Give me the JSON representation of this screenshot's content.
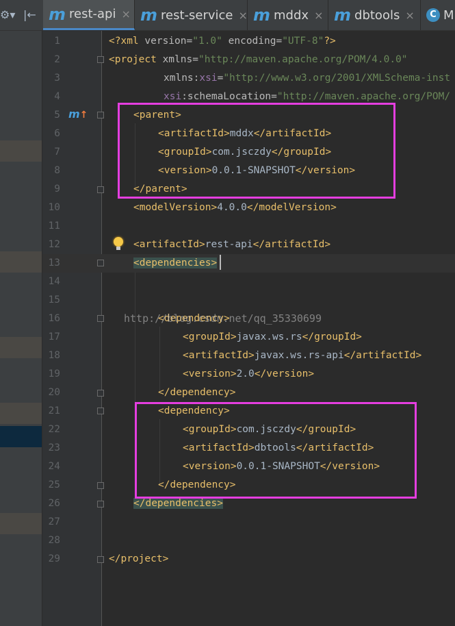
{
  "toolbar": {
    "settings_icon": "⚙▾",
    "collapse_icon": "|←"
  },
  "tabs": [
    {
      "icon": "m",
      "label": "rest-api",
      "close": "×",
      "active": true
    },
    {
      "icon": "m",
      "label": "rest-service",
      "close": "×"
    },
    {
      "icon": "m",
      "label": "mddx",
      "close": "×"
    },
    {
      "icon": "m",
      "label": "dbtools",
      "close": "×"
    },
    {
      "icon": "C",
      "label": "M"
    }
  ],
  "editor": {
    "line_numbers": [
      "1",
      "2",
      "3",
      "4",
      "5",
      "6",
      "7",
      "8",
      "9",
      "10",
      "11",
      "12",
      "13",
      "14",
      "15",
      "16",
      "17",
      "18",
      "19",
      "20",
      "21",
      "22",
      "23",
      "24",
      "25",
      "26",
      "27",
      "28",
      "29"
    ],
    "code": {
      "l1": {
        "a": "<?xml ",
        "b": "version",
        "c": "=",
        "d": "\"1.0\"",
        "e": " ",
        "f": "encoding",
        "g": "=",
        "h": "\"UTF-8\"",
        "i": "?>"
      },
      "l2": {
        "a": "<project ",
        "b": "xmlns",
        "c": "=",
        "d": "\"http://maven.apache.org/POM/4.0.0\""
      },
      "l3": {
        "a": "xmlns",
        "b": ":",
        "c": "xsi",
        "d": "=",
        "e": "\"http://www.w3.org/2001/XMLSchema-inst"
      },
      "l4": {
        "a": "xsi",
        "b": ":schemaLocation",
        "c": "=",
        "d": "\"http://maven.apache.org/POM/"
      },
      "l5": {
        "a": "<parent>"
      },
      "l6": {
        "a": "<artifactId>",
        "b": "mddx",
        "c": "</artifactId>"
      },
      "l7": {
        "a": "<groupId>",
        "b": "com.jsczdy",
        "c": "</groupId>"
      },
      "l8": {
        "a": "<version>",
        "b": "0.0.1-SNAPSHOT",
        "c": "</version>"
      },
      "l9": {
        "a": "</parent>"
      },
      "l10": {
        "a": "<modelVersion>",
        "b": "4.0.0",
        "c": "</modelVersion>"
      },
      "l12": {
        "a": "<artifactId>",
        "b": "rest-api",
        "c": "</artifactId>"
      },
      "l13": {
        "a": "<dependencies>"
      },
      "l16": {
        "a": "<dependency>"
      },
      "l17": {
        "a": "<groupId>",
        "b": "javax.ws.rs",
        "c": "</groupId>"
      },
      "l18": {
        "a": "<artifactId>",
        "b": "javax.ws.rs-api",
        "c": "</artifactId>"
      },
      "l19": {
        "a": "<version>",
        "b": "2.0",
        "c": "</version>"
      },
      "l20": {
        "a": "</dependency>"
      },
      "l21": {
        "a": "<dependency>"
      },
      "l22": {
        "a": "<groupId>",
        "b": "com.jsczdy",
        "c": "</groupId>"
      },
      "l23": {
        "a": "<artifactId>",
        "b": "dbtools",
        "c": "</artifactId>"
      },
      "l24": {
        "a": "<version>",
        "b": "0.0.1-SNAPSHOT",
        "c": "</version>"
      },
      "l25": {
        "a": "</dependency>"
      },
      "l26": {
        "a": "</dependencies>"
      },
      "l29": {
        "a": "</project>"
      }
    },
    "gutter_icons": {
      "maven_icon": "m",
      "maven_arrow": "↑"
    },
    "watermark": "http://blog.csdn.net/qq_35330699"
  },
  "colors": {
    "background": "#2b2b2b",
    "tag": "#e8bf6a",
    "attribute": "#bababa",
    "string": "#6a8759",
    "text": "#a9b7c6",
    "namespace": "#9876aa",
    "highlight_box": "#e53ee0",
    "tab_accent": "#4a88c7"
  }
}
